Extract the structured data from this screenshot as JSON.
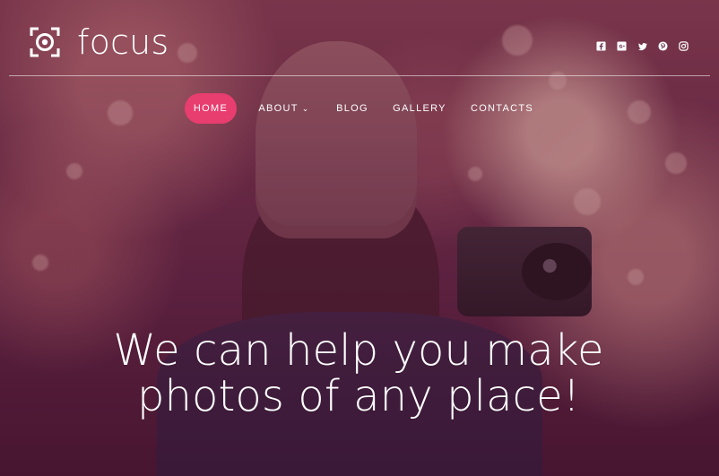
{
  "brand": {
    "name": "focus",
    "logo_icon": "focus-logo-icon"
  },
  "social": [
    {
      "name": "facebook-icon"
    },
    {
      "name": "google-plus-icon"
    },
    {
      "name": "twitter-icon"
    },
    {
      "name": "pinterest-icon"
    },
    {
      "name": "instagram-icon"
    }
  ],
  "nav": {
    "items": [
      {
        "label": "HOME",
        "active": true
      },
      {
        "label": "ABOUT",
        "has_dropdown": true
      },
      {
        "label": "BLOG"
      },
      {
        "label": "GALLERY"
      },
      {
        "label": "CONTACTS"
      }
    ],
    "about_dropdown_icon": "chevron-down-icon"
  },
  "hero": {
    "headline_line_1": "We can help you make",
    "headline_line_2": "photos of any place!"
  },
  "colors": {
    "accent": "#e83d6f",
    "text": "#ffffff",
    "overlay": "#541335"
  }
}
